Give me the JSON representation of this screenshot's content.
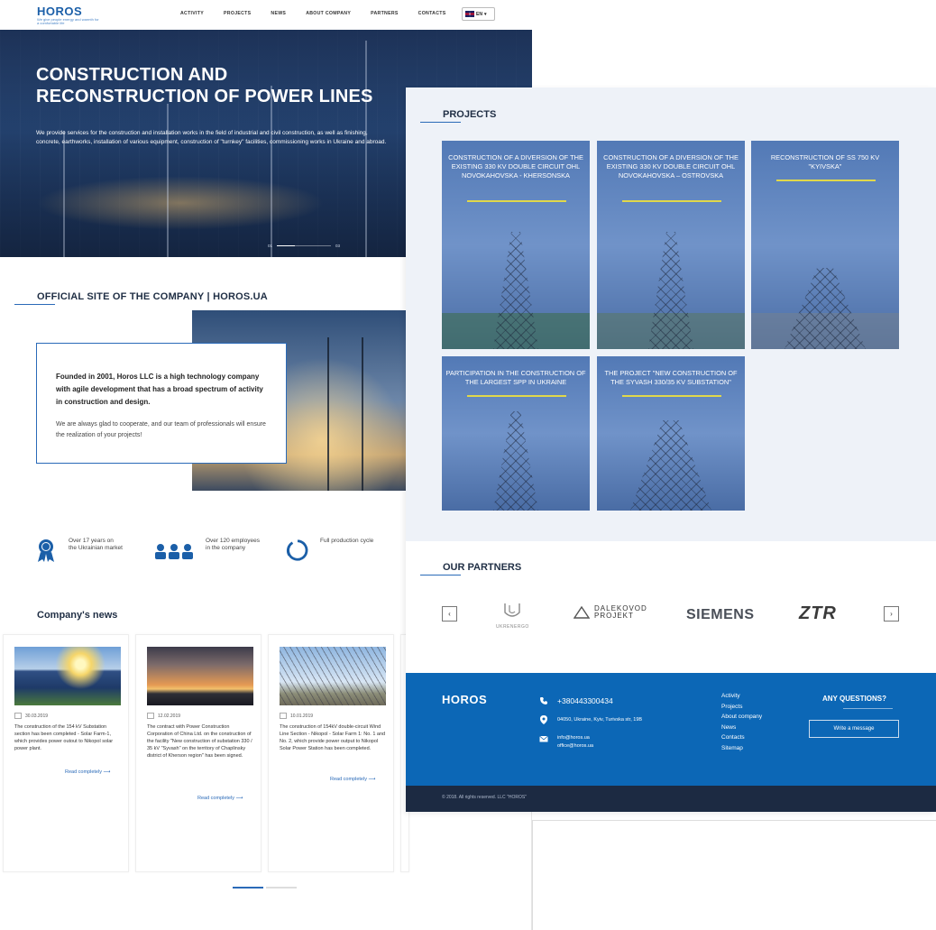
{
  "header": {
    "logo": "HOROS",
    "tagline": "We give people energy and warmth for a comfortable life",
    "nav": [
      "ACTIVITY",
      "PROJECTS",
      "NEWS",
      "ABOUT COMPANY",
      "PARTNERS",
      "CONTACTS"
    ],
    "lang": "EN"
  },
  "hero": {
    "title": "CONSTRUCTION AND RECONSTRUCTION OF POWER LINES",
    "text": "We provide services for the construction and installation works in the field of industrial and civil construction, as well as finishing, concrete, earthworks, installation of various equipment, construction of \"turnkey\" facilities, commissioning works in Ukraine and abroad.",
    "slide_from": "01",
    "slide_to": "03"
  },
  "official": {
    "heading": "OFFICIAL SITE OF THE COMPANY | HOROS.UA",
    "lead": "Founded in 2001, Horos LLC is a high technology company with agile development that has a broad spectrum of activity in construction and design.",
    "text": "We are always glad to cooperate, and our team of professionals will ensure the realization of your projects!"
  },
  "features": [
    {
      "icon": "medal-icon",
      "text": "Over 17 years on the Ukrainian market"
    },
    {
      "icon": "team-icon",
      "text": "Over 120 employees in the company"
    },
    {
      "icon": "cycle-icon",
      "text": "Full production cycle"
    }
  ],
  "news": {
    "heading": "Company's news",
    "read_more": "Read completely",
    "items": [
      {
        "date": "30.03.2019",
        "text": "The construction of the 154 kV Substation section has been completed - Solar Farm-1, which provides power outout to Nikopol solar power plant."
      },
      {
        "date": "12.02.2019",
        "text": "The contract with Power Construction Corporation of China Ltd. on the construction of the facility \"New construction of substation 330 / 35 kV \"Syvash\" on the territory of Chaplinsky district of Kherson region\" has been signed."
      },
      {
        "date": "10.01.2019",
        "text": "The construction of 154kV double-circuit Wind Line Section - Nikopol - Solar Farm 1: No. 1 and No. 2, which provide power output to Nikopol Solar Power Station has been completed."
      }
    ]
  },
  "projects": {
    "heading": "PROJECTS",
    "items": [
      "CONSTRUCTION OF A DIVERSION OF THE EXISTING 330 KV DOUBLE CIRCUIT OHL NOVOKAHOVSKA - KHERSONSKA",
      "CONSTRUCTION OF A DIVERSION OF THE EXISTING 330 KV DOUBLE CIRCUIT OHL NOVOKAHOVSKA – OSTROVSKA",
      "RECONSTRUCTION OF SS 750 KV \"KYIVSKA\"",
      "PARTICIPATION IN THE CONSTRUCTION OF THE LARGEST SPP IN UKRAINE",
      "THE PROJECT \"NEW CONSTRUCTION OF THE SYVASH 330/35 KV SUBSTATION\""
    ]
  },
  "partners": {
    "heading": "OUR PARTNERS",
    "logos": [
      "UKRENERGO",
      "DALEKOVOD PROJEKT",
      "SIEMENS",
      "ZTR"
    ]
  },
  "footer": {
    "logo": "HOROS",
    "phone": "+380443300434",
    "address": "04050, Ukraine, Kyiv, Turivska str, 19B",
    "email1": "info@horos.ua",
    "email2": "office@horos.ua",
    "links": [
      "Activity",
      "Projects",
      "About company",
      "News",
      "Contacts",
      "Sitemap"
    ],
    "ask": "ANY QUESTIONS?",
    "write": "Write a message",
    "copyright": "© 2018. All rights reserved. LLC \"HOROS\""
  },
  "colors": {
    "brand": "#0c67b6",
    "accent_line": "#2a6ab8",
    "project_underline": "#e1d84a",
    "copyright_bg": "#1c2a42"
  }
}
